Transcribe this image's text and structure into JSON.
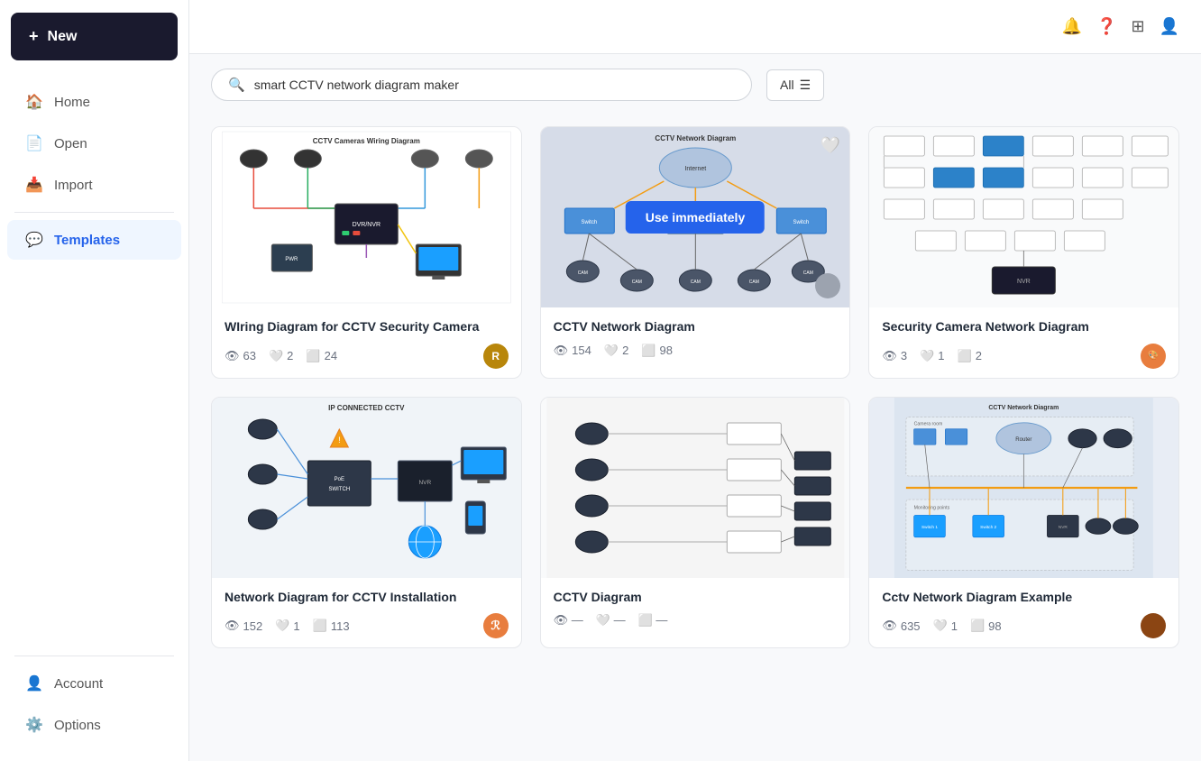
{
  "sidebar": {
    "new_label": "New",
    "items": [
      {
        "id": "home",
        "label": "Home",
        "icon": "🏠"
      },
      {
        "id": "open",
        "label": "Open",
        "icon": "📄"
      },
      {
        "id": "import",
        "label": "Import",
        "icon": "📥"
      },
      {
        "id": "templates",
        "label": "Templates",
        "icon": "💬",
        "active": true
      }
    ],
    "bottom_items": [
      {
        "id": "account",
        "label": "Account",
        "icon": "👤"
      },
      {
        "id": "options",
        "label": "Options",
        "icon": "⚙️"
      }
    ]
  },
  "header": {
    "bell_icon": "🔔",
    "help_icon": "❓",
    "grid_icon": "⊞",
    "user_icon": "👤"
  },
  "search": {
    "placeholder": "smart CCTV network diagram maker",
    "filter_label": "All"
  },
  "templates": [
    {
      "id": 1,
      "title": "WIring Diagram for CCTV Security Camera",
      "views": 63,
      "likes": 2,
      "copies": 24,
      "avatar_color": "#b8860b",
      "avatar_text": "R",
      "diagram_type": "wiring"
    },
    {
      "id": 2,
      "title": "CCTV Network Diagram",
      "views": 154,
      "likes": 2,
      "copies": 98,
      "avatar_color": "#6b7280",
      "avatar_text": "",
      "diagram_type": "network",
      "hovered": true,
      "show_heart": true
    },
    {
      "id": 3,
      "title": "Security Camera Network Diagram",
      "views": 3,
      "likes": 1,
      "copies": 2,
      "avatar_color": "#e87d3e",
      "avatar_text": "",
      "diagram_type": "security"
    },
    {
      "id": 4,
      "title": "Network Diagram for CCTV Installation",
      "views": 152,
      "likes": 1,
      "copies": 113,
      "avatar_color": "#e87d3e",
      "avatar_text": "R",
      "diagram_type": "ip_cctv"
    },
    {
      "id": 5,
      "title": "CCTV Diagram",
      "views": 0,
      "likes": 0,
      "copies": 0,
      "avatar_color": "#6b7280",
      "avatar_text": "",
      "diagram_type": "cctv_simple"
    },
    {
      "id": 6,
      "title": "Cctv Network Diagram Example",
      "views": 635,
      "likes": 1,
      "copies": 98,
      "avatar_color": "#8b4513",
      "avatar_text": "",
      "diagram_type": "cctv_example"
    }
  ],
  "use_immediately_label": "Use immediately"
}
